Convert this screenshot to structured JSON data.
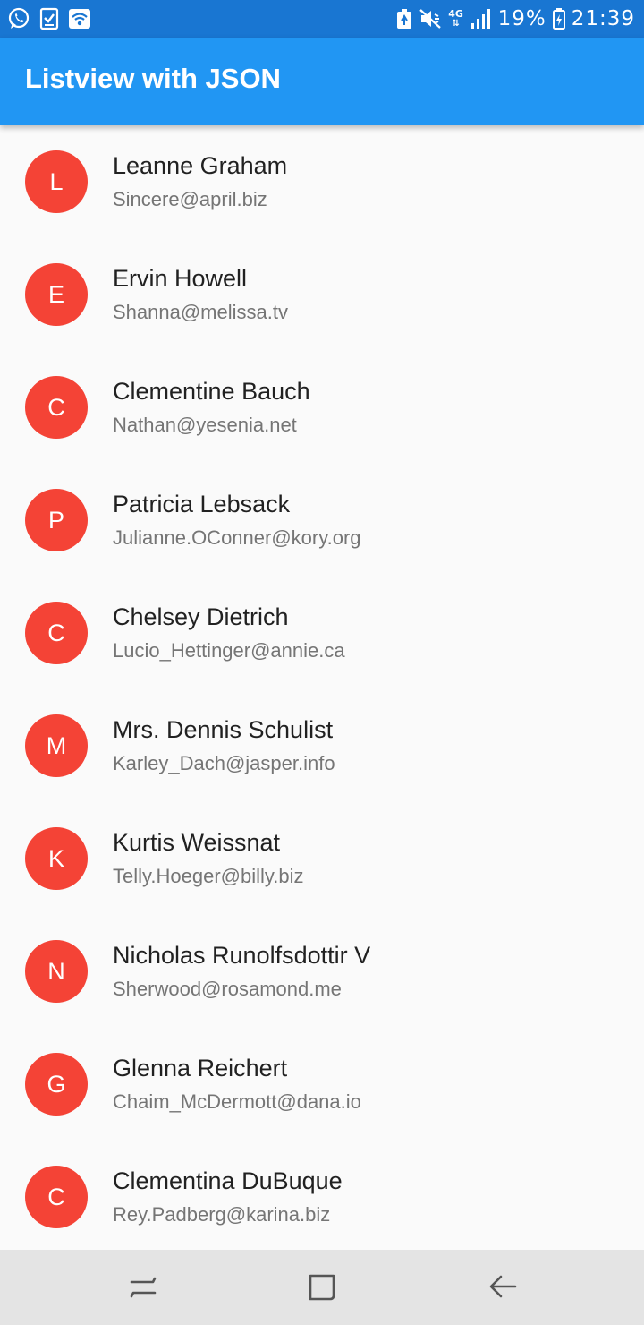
{
  "status_bar": {
    "left_icons": [
      "whatsapp-icon",
      "checklist-icon",
      "wifi-calling-icon"
    ],
    "right_icons": [
      "battery-saver-icon",
      "mute-icon",
      "lte-icon",
      "signal-icon",
      "battery-icon"
    ],
    "network": "4G",
    "battery": "19%",
    "time": "21:39"
  },
  "app_bar": {
    "title": "Listview with JSON",
    "color": "#2196f3"
  },
  "avatar_color": "#f44336",
  "users": [
    {
      "initial": "L",
      "name": "Leanne Graham",
      "email": "Sincere@april.biz"
    },
    {
      "initial": "E",
      "name": "Ervin Howell",
      "email": "Shanna@melissa.tv"
    },
    {
      "initial": "C",
      "name": "Clementine Bauch",
      "email": "Nathan@yesenia.net"
    },
    {
      "initial": "P",
      "name": "Patricia Lebsack",
      "email": "Julianne.OConner@kory.org"
    },
    {
      "initial": "C",
      "name": "Chelsey Dietrich",
      "email": "Lucio_Hettinger@annie.ca"
    },
    {
      "initial": "M",
      "name": "Mrs. Dennis Schulist",
      "email": "Karley_Dach@jasper.info"
    },
    {
      "initial": "K",
      "name": "Kurtis Weissnat",
      "email": "Telly.Hoeger@billy.biz"
    },
    {
      "initial": "N",
      "name": "Nicholas Runolfsdottir V",
      "email": "Sherwood@rosamond.me"
    },
    {
      "initial": "G",
      "name": "Glenna Reichert",
      "email": "Chaim_McDermott@dana.io"
    },
    {
      "initial": "C",
      "name": "Clementina DuBuque",
      "email": "Rey.Padberg@karina.biz"
    }
  ],
  "nav_bar": {
    "buttons": [
      "recent-apps-icon",
      "home-icon",
      "back-icon"
    ]
  }
}
